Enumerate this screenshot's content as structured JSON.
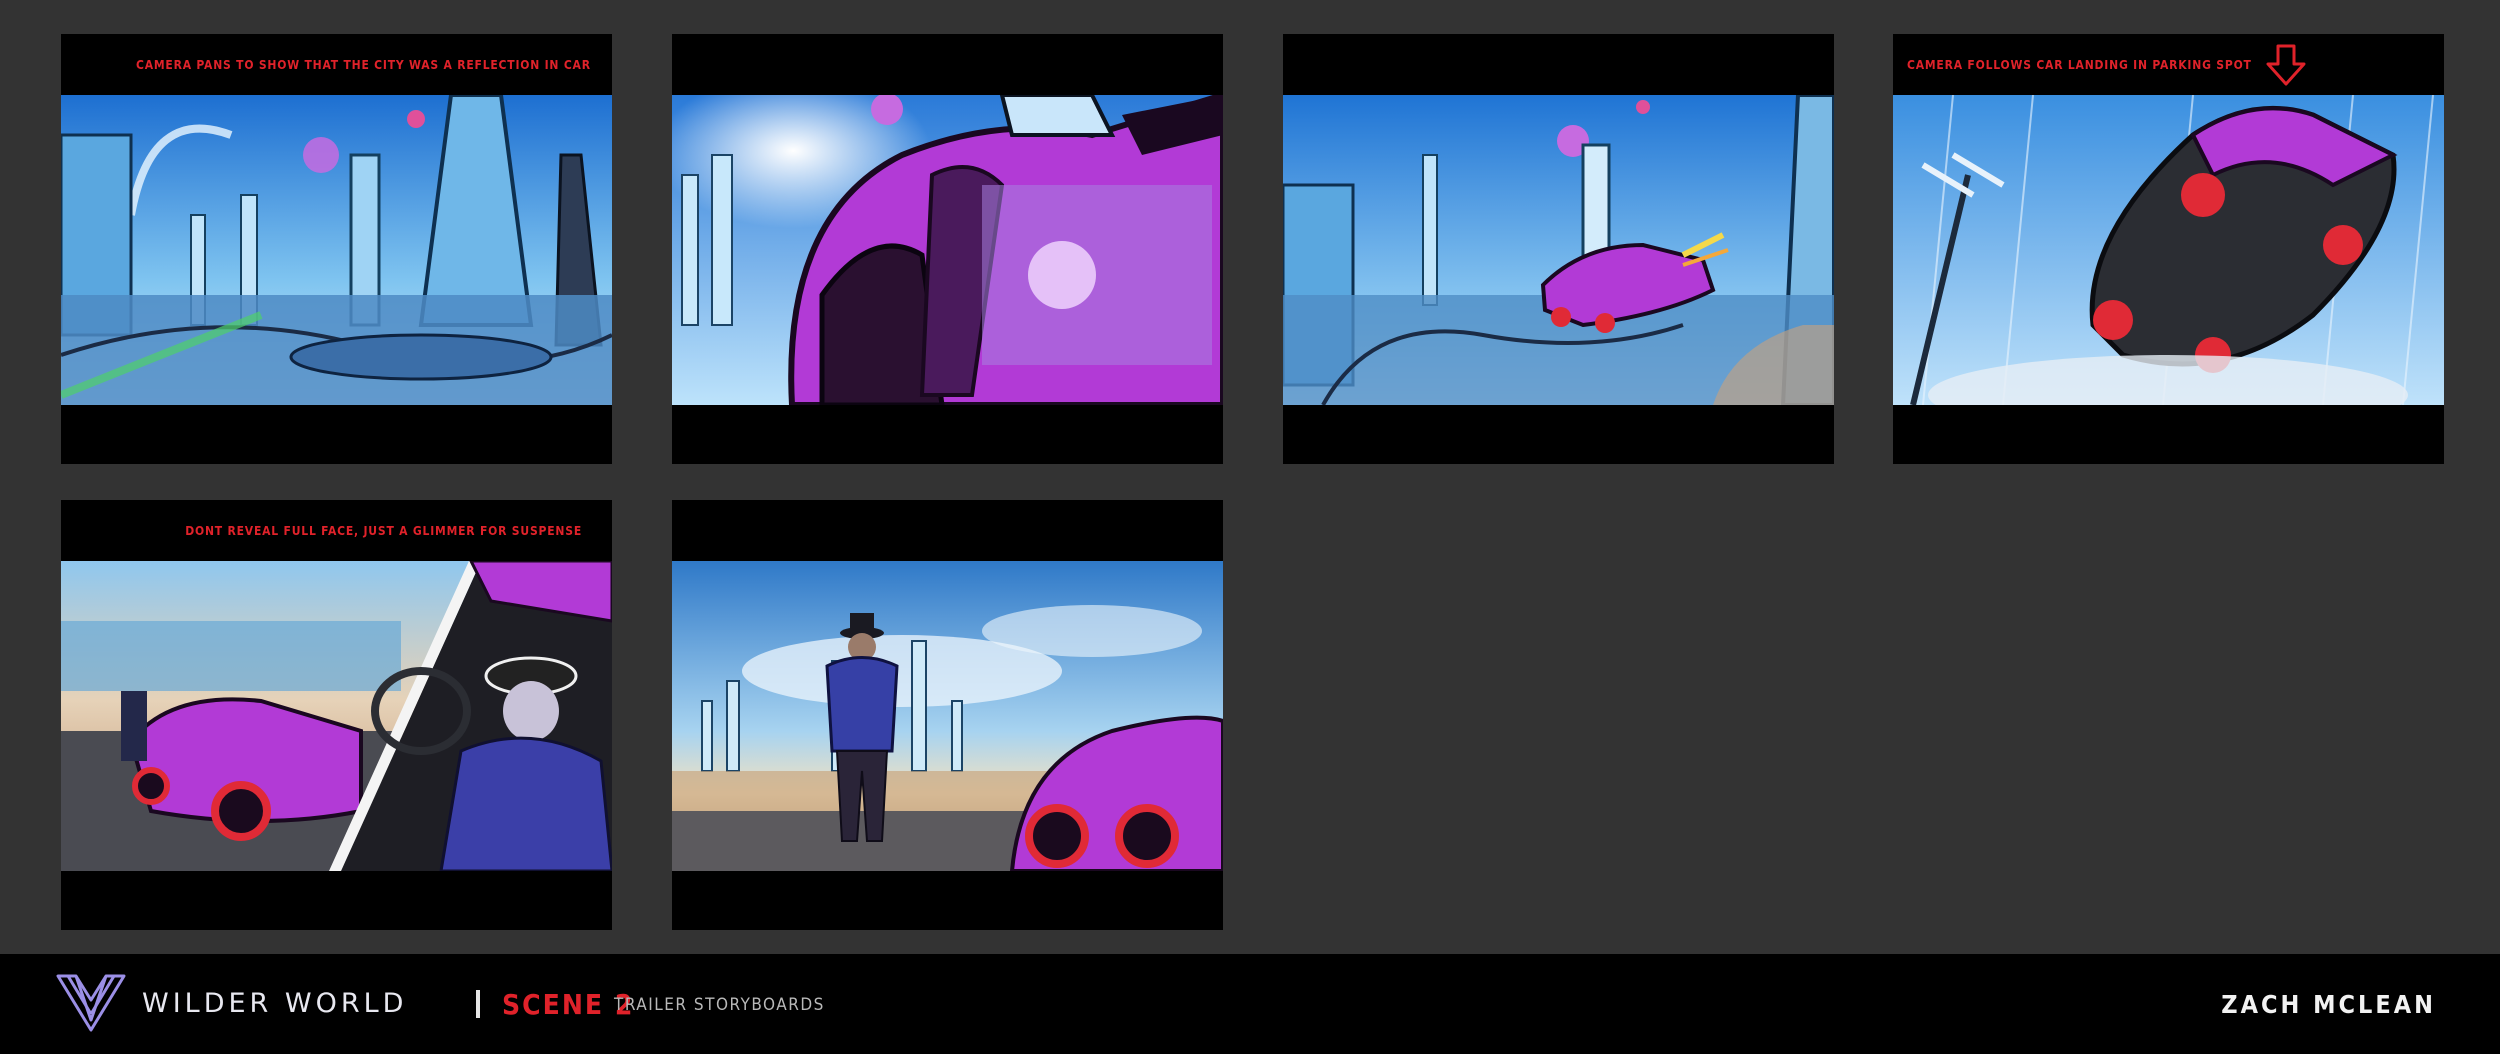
{
  "panels": [
    {
      "caption": "CAMERA PANS TO SHOW THAT THE CITY WAS A REFLECTION IN CAR",
      "scene": "futuristic-city-reflection"
    },
    {
      "caption": "",
      "scene": "car-wheel-closeup-city-reflection"
    },
    {
      "caption": "",
      "scene": "flying-car-over-city"
    },
    {
      "caption": "CAMERA FOLLOWS CAR LANDING IN PARKING SPOT",
      "scene": "car-landing-from-above",
      "arrow_icon": "down-arrow-icon"
    },
    {
      "caption": "DONT REVEAL FULL FACE, JUST A GLIMMER FOR SUSPENSE",
      "scene": "driver-exiting-car-split"
    },
    {
      "caption": "",
      "scene": "man-looking-at-city-by-car"
    }
  ],
  "footer": {
    "brand": "WILDER WORLD",
    "scene_label": "SCENE 2",
    "subtitle": "TRAILER STORYBOARDS",
    "author": "ZACH MCLEAN",
    "logo_icon": "wilder-world-logo-icon"
  },
  "colors": {
    "background": "#333333",
    "panel": "#000000",
    "caption": "#e0222a",
    "car": "#b23ad6",
    "sky": "#2e8fe0"
  }
}
